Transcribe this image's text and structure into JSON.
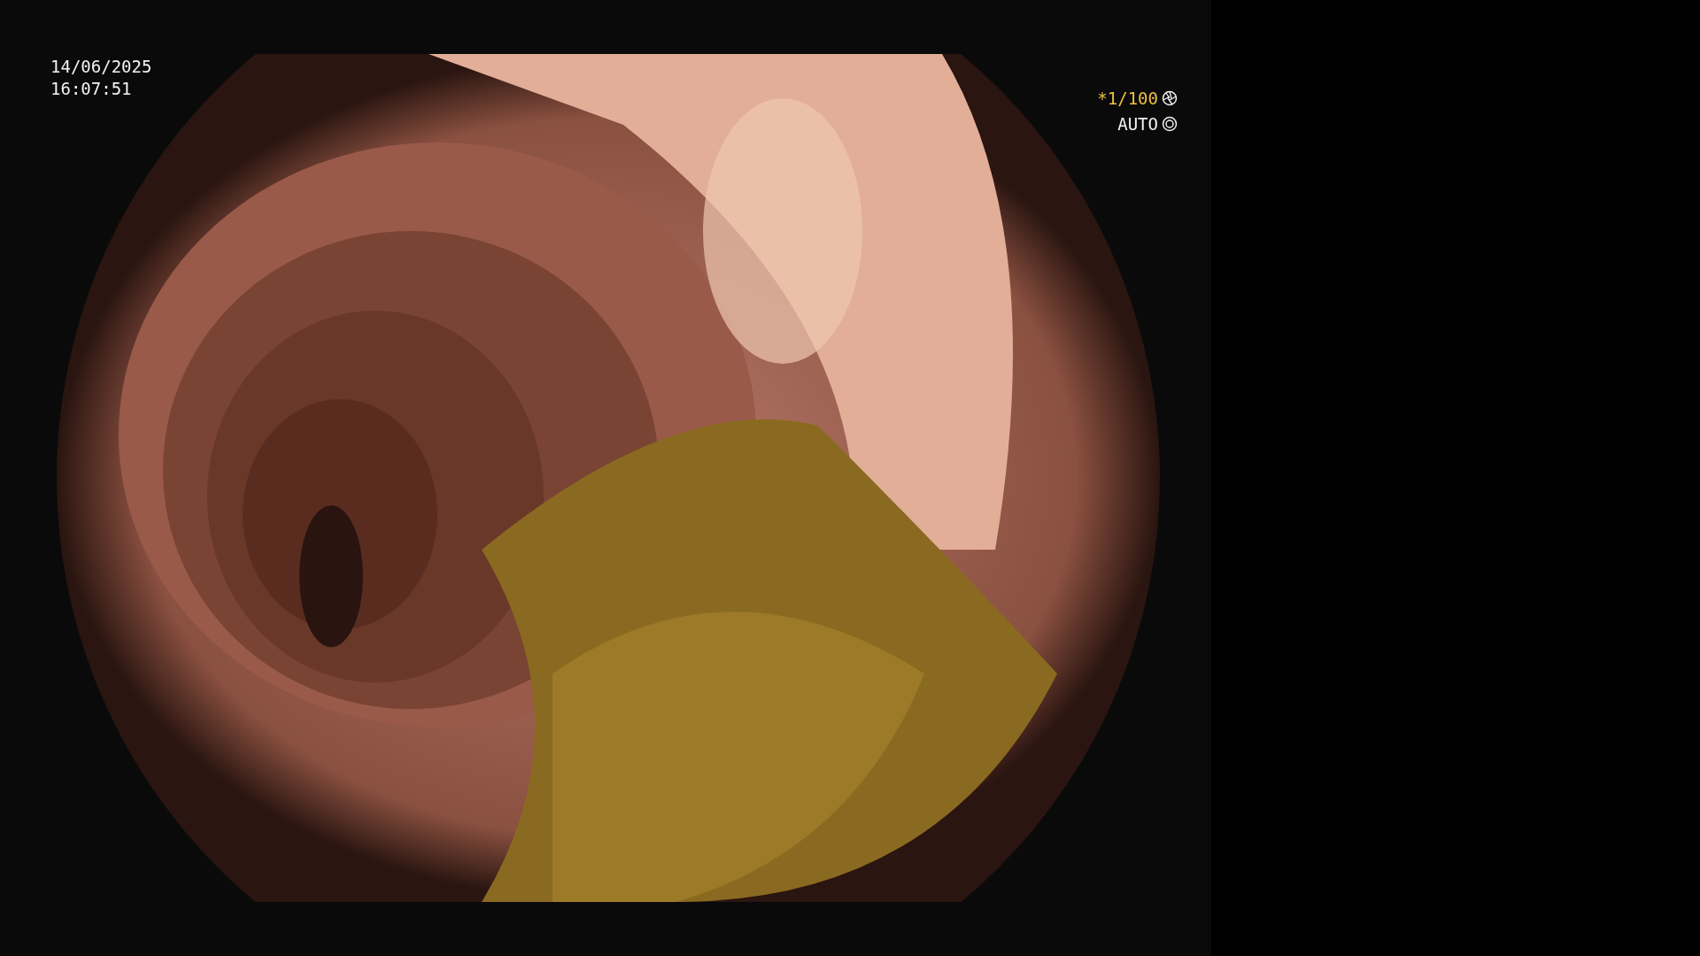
{
  "overlay": {
    "date": "14/06/2025",
    "time": "16:07:51",
    "shutter": "*1/100",
    "mode": "AUTO"
  }
}
